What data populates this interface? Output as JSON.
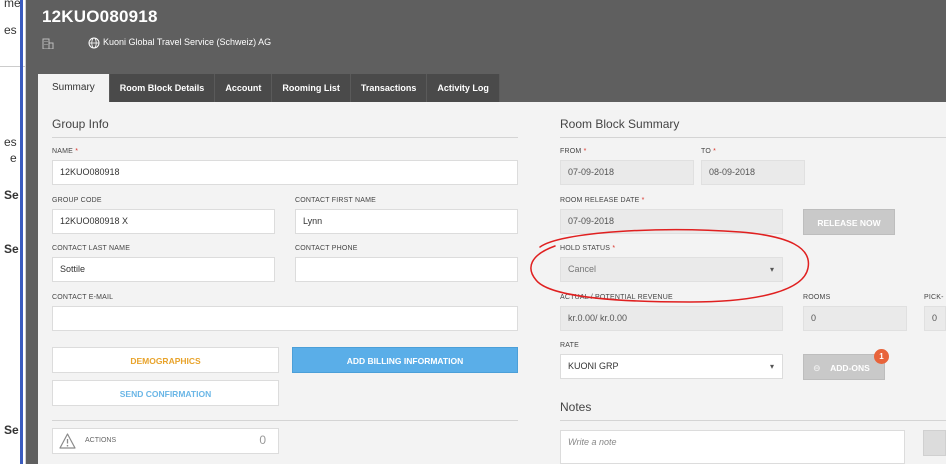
{
  "background": {
    "fragments": [
      "me",
      "es",
      "es",
      "e",
      "Se",
      "Se",
      "Se"
    ]
  },
  "header": {
    "title": "12KUO080918",
    "company": "Kuoni Global Travel Service (Schweiz) AG"
  },
  "tabs": [
    {
      "label": "Summary"
    },
    {
      "label": "Room Block Details"
    },
    {
      "label": "Account"
    },
    {
      "label": "Rooming List"
    },
    {
      "label": "Transactions"
    },
    {
      "label": "Activity Log"
    }
  ],
  "group_info": {
    "title": "Group Info",
    "name_label": "NAME",
    "name_value": "12KUO080918",
    "group_code_label": "GROUP CODE",
    "group_code_value": "12KUO080918 X",
    "contact_first_label": "CONTACT FIRST NAME",
    "contact_first_value": "Lynn",
    "contact_last_label": "CONTACT LAST NAME",
    "contact_last_value": "Sottile",
    "contact_phone_label": "CONTACT PHONE",
    "contact_phone_value": "",
    "contact_email_label": "CONTACT E-MAIL",
    "contact_email_value": "",
    "demographics_label": "DEMOGRAPHICS",
    "add_billing_label": "ADD BILLING INFORMATION",
    "send_confirmation_label": "SEND CONFIRMATION",
    "actions_label": "ACTIONS",
    "actions_count": "0"
  },
  "room_block_summary": {
    "title": "Room Block Summary",
    "from_label": "FROM",
    "from_value": "07-09-2018",
    "to_label": "TO",
    "to_value": "08-09-2018",
    "release_date_label": "ROOM RELEASE DATE",
    "release_date_value": "07-09-2018",
    "release_now_label": "RELEASE NOW",
    "hold_status_label": "HOLD STATUS",
    "hold_status_value": "Cancel",
    "revenue_label": "ACTUAL / POTENTIAL REVENUE",
    "revenue_value": "kr.0.00/ kr.0.00",
    "rooms_label": "ROOMS",
    "rooms_value": "0",
    "pickup_label": "PICK-",
    "pickup_value": "0",
    "rate_label": "RATE",
    "rate_value": "KUONI GRP",
    "addons_label": "ADD-ONS",
    "addons_badge": "1"
  },
  "notes": {
    "title": "Notes",
    "placeholder": "Write a note"
  },
  "colors": {
    "modal_bg": "#5f5f5f",
    "tab_bg": "#4a4a4a",
    "panel_bg": "#f3f3f3",
    "demographics_text": "#e8a32b",
    "send_confirmation_text": "#6ab6e6",
    "primary_button": "#5aaee8",
    "disabled_button": "#c9c9c9",
    "required_marker": "#d9342b",
    "badge": "#e8633a",
    "annotation": "#e02020"
  },
  "icons": [
    "building-icon",
    "globe-icon",
    "warning-icon",
    "add-ons-icon",
    "chevron-down-icon"
  ]
}
